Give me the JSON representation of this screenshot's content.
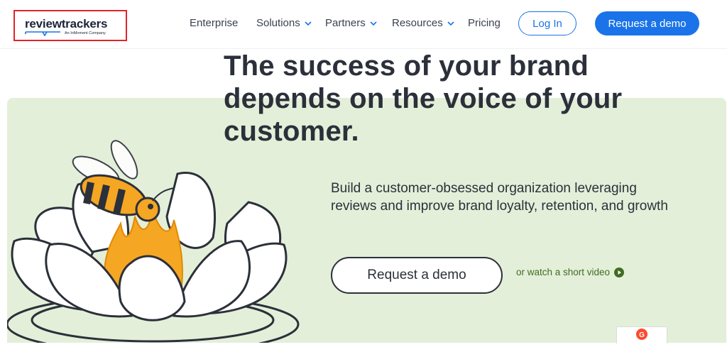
{
  "header": {
    "logo": {
      "wordmark": "reviewtrackers",
      "tagline": "An InMoment Company"
    },
    "nav": {
      "enterprise": "Enterprise",
      "solutions": "Solutions",
      "partners": "Partners",
      "resources": "Resources",
      "pricing": "Pricing"
    },
    "login_label": "Log In",
    "demo_label": "Request a demo"
  },
  "hero": {
    "headline": "The success of your brand depends on the voice of your customer.",
    "subheadline": "Build a customer-obsessed organization leveraging reviews and improve brand loyalty, retention, and growth",
    "demo_button": "Request a demo",
    "video_link": "or watch a short video",
    "badge_letter": "G"
  },
  "colors": {
    "accent_blue": "#1a73e8",
    "hero_green": "#e4efd9",
    "logo_highlight_border": "#e0242c",
    "link_green": "#3f6d22",
    "flame_orange": "#f5a623"
  },
  "icons": [
    "chevron-down-icon",
    "play-icon",
    "bee-icon",
    "lotus-illustration",
    "g2-icon"
  ]
}
